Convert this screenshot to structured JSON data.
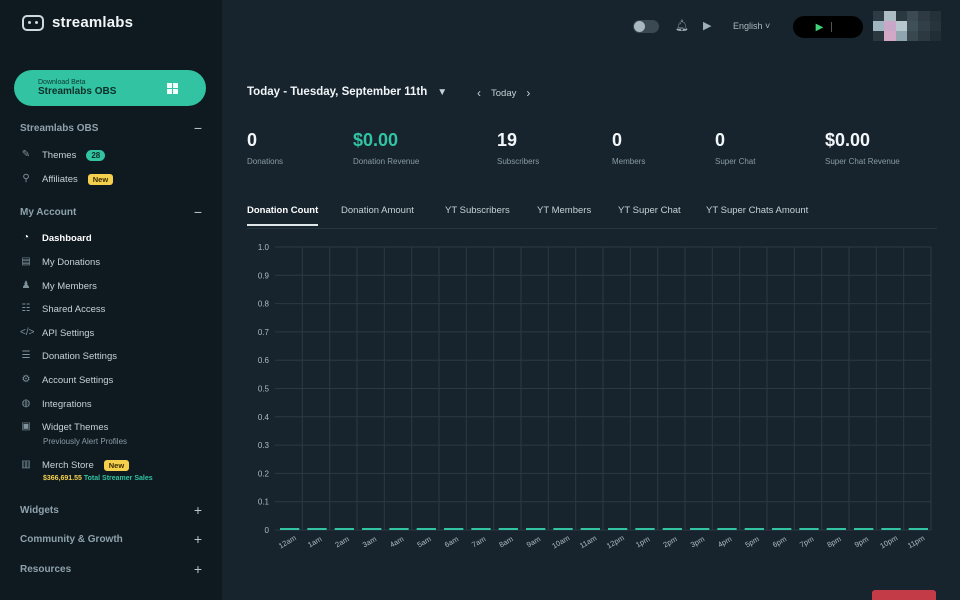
{
  "brand": {
    "name": "streamlabs"
  },
  "download": {
    "line1": "Download Beta",
    "line2": "Streamlabs OBS"
  },
  "sidebar": {
    "section_obs": {
      "title": "Streamlabs OBS",
      "toggle": "−"
    },
    "themes": {
      "label": "Themes",
      "badge": "28"
    },
    "affiliates": {
      "label": "Affiliates",
      "badge": "New"
    },
    "section_account": {
      "title": "My Account",
      "toggle": "−"
    },
    "items": [
      {
        "label": "Dashboard"
      },
      {
        "label": "My Donations"
      },
      {
        "label": "My Members"
      },
      {
        "label": "Shared Access"
      },
      {
        "label": "API Settings"
      },
      {
        "label": "Donation Settings"
      },
      {
        "label": "Account Settings"
      },
      {
        "label": "Integrations"
      },
      {
        "label": "Widget Themes"
      }
    ],
    "widget_themes_sub": "Previously Alert Profiles",
    "merch": {
      "label": "Merch Store",
      "badge": "New",
      "amount": "$366,691.55",
      "amount_label": "Total Streamer Sales"
    },
    "widgets": {
      "title": "Widgets",
      "toggle": "+"
    },
    "community": {
      "title": "Community & Growth",
      "toggle": "+"
    },
    "resources": {
      "title": "Resources",
      "toggle": "+"
    }
  },
  "topbar": {
    "language": "English ˅"
  },
  "date": {
    "label": "Today - Tuesday, September 11th",
    "today": "Today"
  },
  "stats": [
    {
      "value": "0",
      "label": "Donations"
    },
    {
      "value": "$0.00",
      "label": "Donation Revenue"
    },
    {
      "value": "19",
      "label": "Subscribers"
    },
    {
      "value": "0",
      "label": "Members"
    },
    {
      "value": "0",
      "label": "Super Chat"
    },
    {
      "value": "$0.00",
      "label": "Super Chat Revenue"
    }
  ],
  "tabs": [
    {
      "label": "Donation Count"
    },
    {
      "label": "Donation Amount"
    },
    {
      "label": "YT Subscribers"
    },
    {
      "label": "YT Members"
    },
    {
      "label": "YT Super Chat"
    },
    {
      "label": "YT Super Chats Amount"
    }
  ],
  "colors": {
    "accent": "#31c3a2",
    "sidebar_bg": "#0f1a20",
    "main_bg": "#17242d",
    "badge_yellow": "#f5d04d"
  },
  "chart_data": {
    "type": "bar",
    "title": "",
    "xlabel": "",
    "ylabel": "",
    "ylim": [
      0,
      1
    ],
    "yticks": [
      "1.0",
      "0.9",
      "0.8",
      "0.7",
      "0.6",
      "0.5",
      "0.4",
      "0.3",
      "0.2",
      "0.1",
      "0"
    ],
    "categories": [
      "12am",
      "1am",
      "2am",
      "3am",
      "4am",
      "5am",
      "6am",
      "7am",
      "8am",
      "9am",
      "10am",
      "11am",
      "12pm",
      "1pm",
      "2pm",
      "3pm",
      "4pm",
      "5pm",
      "6pm",
      "7pm",
      "8pm",
      "9pm",
      "10pm",
      "11pm"
    ],
    "values": [
      0,
      0,
      0,
      0,
      0,
      0,
      0,
      0,
      0,
      0,
      0,
      0,
      0,
      0,
      0,
      0,
      0,
      0,
      0,
      0,
      0,
      0,
      0,
      0
    ],
    "grid": true,
    "bar_color": "#31c3a2"
  }
}
